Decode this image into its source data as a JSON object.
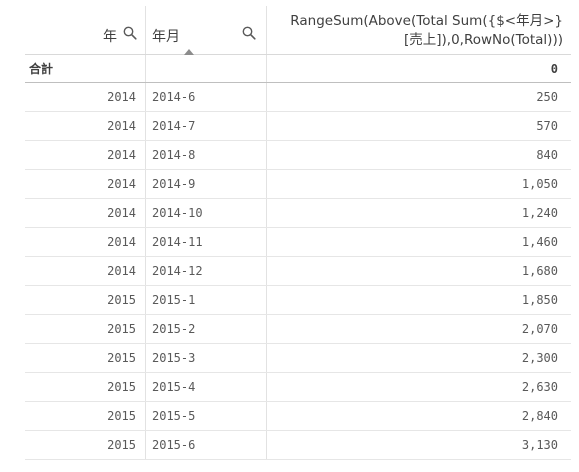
{
  "header": {
    "col1_label": "年",
    "col2_label": "年月",
    "col3_label": "RangeSum(Above(Total Sum({$<年月>}[売上]),0,RowNo(Total)))"
  },
  "totals": {
    "label": "合計",
    "value": "0"
  },
  "rows": [
    {
      "year": "2014",
      "month": "2014-6",
      "value": "250"
    },
    {
      "year": "2014",
      "month": "2014-7",
      "value": "570"
    },
    {
      "year": "2014",
      "month": "2014-8",
      "value": "840"
    },
    {
      "year": "2014",
      "month": "2014-9",
      "value": "1,050"
    },
    {
      "year": "2014",
      "month": "2014-10",
      "value": "1,240"
    },
    {
      "year": "2014",
      "month": "2014-11",
      "value": "1,460"
    },
    {
      "year": "2014",
      "month": "2014-12",
      "value": "1,680"
    },
    {
      "year": "2015",
      "month": "2015-1",
      "value": "1,850"
    },
    {
      "year": "2015",
      "month": "2015-2",
      "value": "2,070"
    },
    {
      "year": "2015",
      "month": "2015-3",
      "value": "2,300"
    },
    {
      "year": "2015",
      "month": "2015-4",
      "value": "2,630"
    },
    {
      "year": "2015",
      "month": "2015-5",
      "value": "2,840"
    },
    {
      "year": "2015",
      "month": "2015-6",
      "value": "3,130"
    }
  ],
  "icons": {
    "search": "search-icon",
    "sort": "sort-ascending-icon"
  },
  "colors": {
    "text": "#595959",
    "header_text": "#404040",
    "grid_line": "#e6e6e6"
  }
}
